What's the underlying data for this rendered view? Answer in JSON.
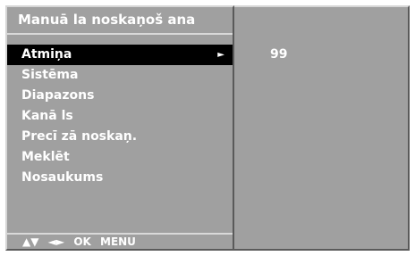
{
  "menu": {
    "title": "Manuā la noskaņoš ana",
    "items": [
      {
        "label": "Atmiņa",
        "selected": true,
        "arrow": "►"
      },
      {
        "label": "Sistēma"
      },
      {
        "label": "Diapazons"
      },
      {
        "label": "Kanā ls"
      },
      {
        "label": "Precī zā noskaņ."
      },
      {
        "label": "Meklēt"
      },
      {
        "label": "Nosaukums"
      }
    ]
  },
  "help": {
    "up_down": "▲▼",
    "left_right": "◄►",
    "ok": "OK",
    "menu": "MENU"
  },
  "value_panel": {
    "value": "99"
  },
  "colors": {
    "panel_bg": "#a0a0a0",
    "selected_bg": "#000000",
    "text": "#ffffff"
  }
}
